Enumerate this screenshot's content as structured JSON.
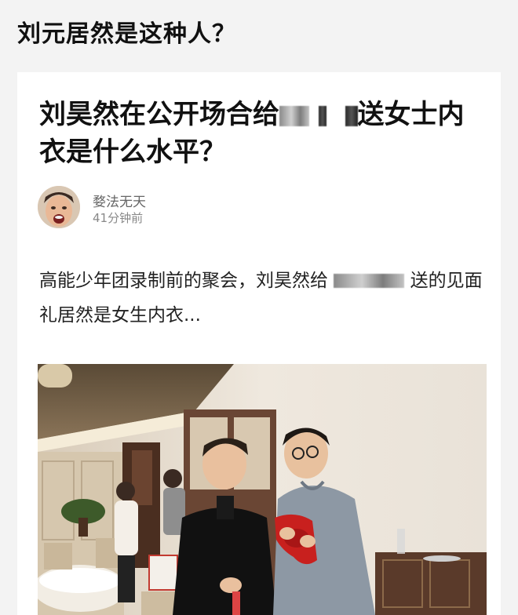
{
  "outer_title": "刘元居然是这种人？",
  "article": {
    "headline_part1": "刘昊然在公开场合给",
    "headline_part2": "送女士内衣是什么水平？",
    "author_name": "婺法无天",
    "author_time": "41分钟前",
    "body_part1": "高能少年团录制前的聚会，刘昊然给",
    "body_part2": "送的见面礼居然是女生内衣..."
  },
  "colors": {
    "background": "#f3f3f3",
    "card": "#ffffff",
    "text": "#111111",
    "muted": "#888888"
  }
}
